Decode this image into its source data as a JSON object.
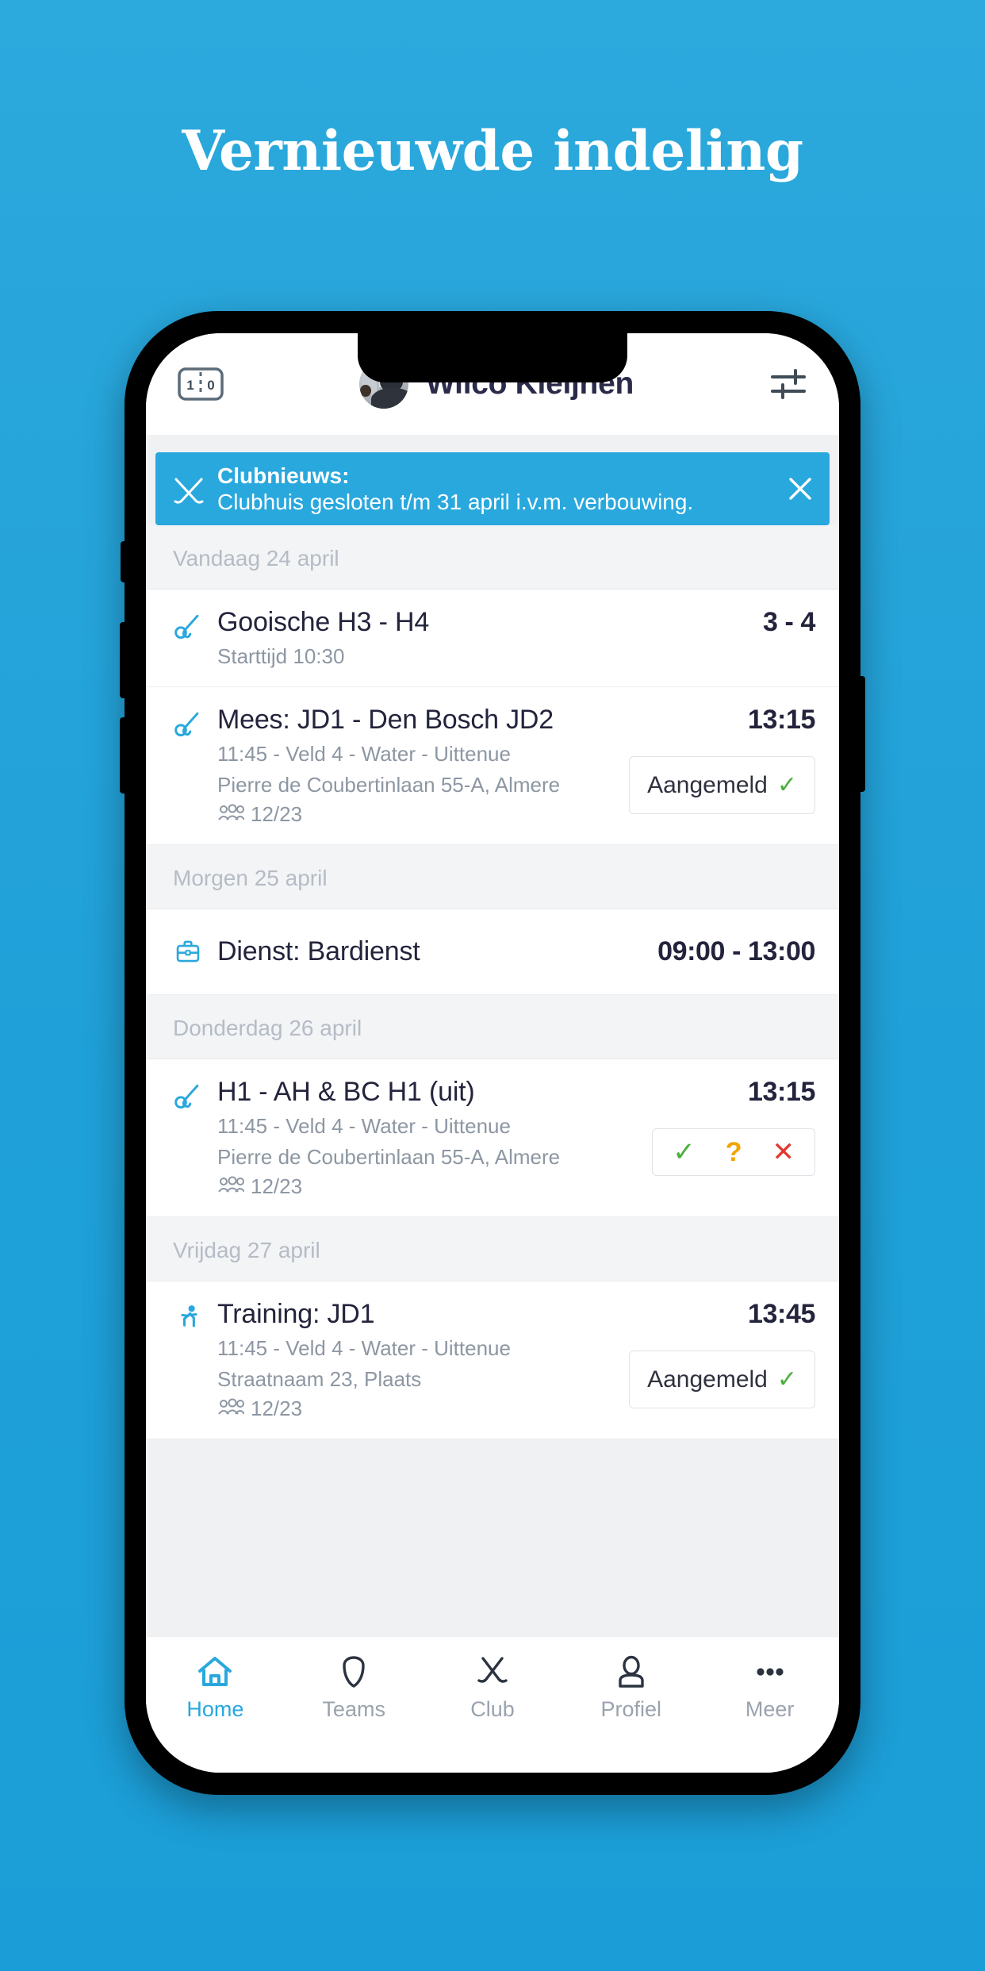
{
  "headline": "Vernieuwde indeling",
  "header": {
    "score_icon": "scoreboard-icon",
    "score_left": "1",
    "score_right": "0",
    "user_name": "Wilco Kleijnen",
    "settings_icon": "sliders-icon",
    "avatar": "user-avatar"
  },
  "banner": {
    "icon": "crossed-hockey-sticks-icon",
    "title": "Clubnieuws:",
    "message": "Clubhuis gesloten t/m 31 april i.v.m. verbouwing.",
    "close_icon": "close-icon",
    "color": "#29a8dd"
  },
  "sections": [
    {
      "day_label": "Vandaag 24 april",
      "items": [
        {
          "icon": "hockey-stick-ball-icon",
          "title": "Gooische H3 - H4",
          "sub": "Starttijd 10:30",
          "right_value": "3 - 4",
          "action": "none"
        },
        {
          "icon": "hockey-stick-ball-icon",
          "title": "Mees: JD1 - Den Bosch JD2",
          "sub": "11:45 - Veld 4 - Water - Uittenue",
          "address": "Pierre de Coubertinlaan 55-A, Almere",
          "attendance": "12/23",
          "right_value": "13:15",
          "action": "aangemeld",
          "action_label": "Aangemeld"
        }
      ]
    },
    {
      "day_label": "Morgen 25 april",
      "items": [
        {
          "icon": "briefcase-icon",
          "title": "Dienst: Bardienst",
          "right_value": "09:00 - 13:00",
          "action": "none"
        }
      ]
    },
    {
      "day_label": "Donderdag 26 april",
      "items": [
        {
          "icon": "hockey-stick-ball-icon",
          "title": "H1 - AH & BC H1 (uit)",
          "sub": "11:45 - Veld 4 - Water - Uittenue",
          "address": "Pierre de Coubertinlaan 55-A, Almere",
          "attendance": "12/23",
          "right_value": "13:15",
          "action": "rsvp",
          "rsvp": {
            "yes": "✓",
            "maybe": "?",
            "no": "✕"
          }
        }
      ]
    },
    {
      "day_label": "Vrijdag 27 april",
      "items": [
        {
          "icon": "running-person-icon",
          "title": "Training: JD1",
          "sub": "11:45 - Veld 4 - Water - Uittenue",
          "address": "Straatnaam 23, Plaats",
          "attendance": "12/23",
          "right_value": "13:45",
          "action": "aangemeld",
          "action_label": "Aangemeld"
        }
      ]
    }
  ],
  "tabbar": [
    {
      "icon": "home-icon",
      "label": "Home",
      "active": true
    },
    {
      "icon": "shield-icon",
      "label": "Teams",
      "active": false
    },
    {
      "icon": "crossed-sticks-icon",
      "label": "Club",
      "active": false
    },
    {
      "icon": "person-icon",
      "label": "Profiel",
      "active": false
    },
    {
      "icon": "ellipsis-icon",
      "label": "Meer",
      "active": false
    }
  ],
  "colors": {
    "accent": "#29a8dd",
    "text_dark": "#23243c",
    "text_muted": "#8d97a3"
  }
}
